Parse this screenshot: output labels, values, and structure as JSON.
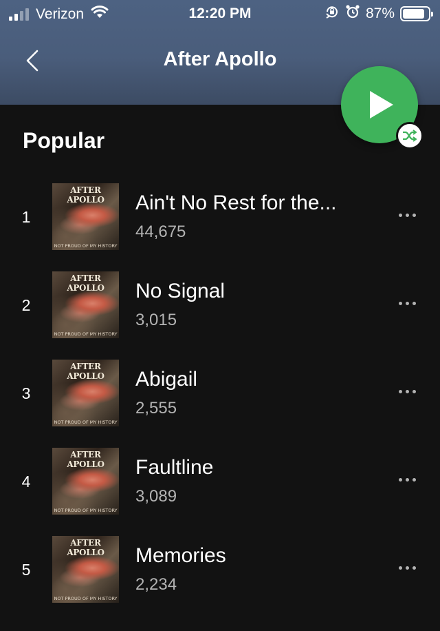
{
  "status_bar": {
    "carrier": "Verizon",
    "time": "12:20 PM",
    "battery_percent": "87%",
    "battery_level": 0.87,
    "icons": [
      "signal-icon",
      "wifi-icon",
      "orientation-lock-icon",
      "alarm-icon",
      "battery-icon"
    ]
  },
  "header": {
    "title": "After Apollo",
    "back_icon": "chevron-left-icon",
    "play_icon": "play-icon",
    "shuffle_icon": "shuffle-icon"
  },
  "colors": {
    "header": "#4a5d7b",
    "background": "#121212",
    "accent_green": "#3fb35b",
    "secondary_text": "#b3b3b3"
  },
  "section": {
    "title": "Popular"
  },
  "album_art": {
    "title": "AFTER APOLLO",
    "subtitle": "NOT PROUD OF MY HISTORY"
  },
  "tracks": [
    {
      "number": "1",
      "name": "Ain't No Rest for the...",
      "plays": "44,675"
    },
    {
      "number": "2",
      "name": "No Signal",
      "plays": "3,015"
    },
    {
      "number": "3",
      "name": "Abigail",
      "plays": "2,555"
    },
    {
      "number": "4",
      "name": "Faultline",
      "plays": "3,089"
    },
    {
      "number": "5",
      "name": "Memories",
      "plays": "2,234"
    }
  ]
}
